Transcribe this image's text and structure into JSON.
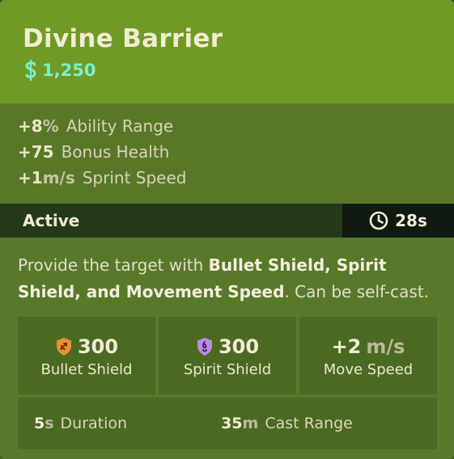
{
  "item": {
    "title": "Divine Barrier",
    "cost": "1,250"
  },
  "stats": [
    {
      "value": "+8",
      "unit": "%",
      "label": "Ability Range"
    },
    {
      "value": "+75",
      "unit": "",
      "label": "Bonus Health"
    },
    {
      "value": "+1",
      "unit": "m/s",
      "label": "Sprint Speed"
    }
  ],
  "active": {
    "label": "Active",
    "cooldown": "28s"
  },
  "description": {
    "pre": "Provide the target with ",
    "bold": "Bullet Shield, Spirit Shield, and Movement Speed",
    "post": ". Can be self-cast."
  },
  "effects": [
    {
      "value": "300",
      "unit": "",
      "label": "Bullet Shield",
      "icon": "bullet-shield-icon"
    },
    {
      "value": "300",
      "unit": "",
      "label": "Spirit Shield",
      "icon": "spirit-shield-icon"
    },
    {
      "value": "+2",
      "unit": "m/s",
      "label": "Move Speed",
      "icon": ""
    }
  ],
  "footer": [
    {
      "value": "5",
      "unit": "s",
      "label": "Duration"
    },
    {
      "value": "35",
      "unit": "m",
      "label": "Cast Range"
    }
  ],
  "colors": {
    "header_bg": "#6f9a25",
    "cost": "#7cf0cd",
    "bullet_shield": "#e8922f",
    "spirit_shield": "#b98ee6"
  }
}
